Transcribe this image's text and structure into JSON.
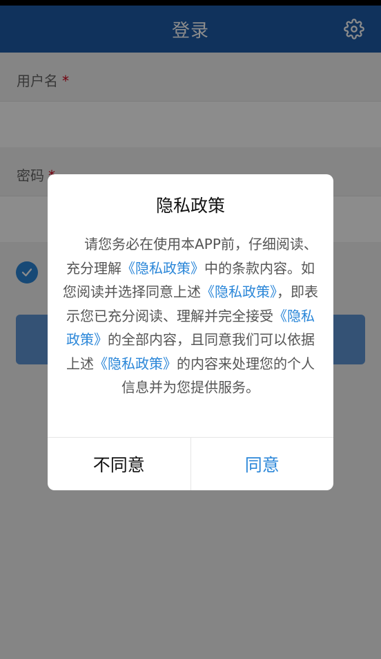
{
  "header": {
    "title": "登录"
  },
  "form": {
    "username_label": "用户名",
    "password_label": "密码",
    "required_mark": "*"
  },
  "dialog": {
    "title": "隐私政策",
    "body": [
      {
        "t": "请您务必在使用本APP前，仔细阅读、充分理解"
      },
      {
        "t": "《隐私政策》",
        "link": true
      },
      {
        "t": "中的条款内容。如您阅读并选择同意上述"
      },
      {
        "t": "《隐私政策》",
        "link": true
      },
      {
        "t": "，即表示您已充分阅读、理解并完全接受"
      },
      {
        "t": "《隐私政策》",
        "link": true
      },
      {
        "t": "的全部内容，且同意我们可以依据上述"
      },
      {
        "t": "《隐私政策》",
        "link": true
      },
      {
        "t": "的内容来处理您的个人信息并为您提供服务。"
      }
    ],
    "disagree_label": "不同意",
    "agree_label": "同意"
  },
  "colors": {
    "header_bg": "#1e5ba8",
    "link": "#2a86d8",
    "required": "#d0021b"
  },
  "icons": {
    "settings": "gear-icon",
    "checkbox": "check-icon"
  }
}
